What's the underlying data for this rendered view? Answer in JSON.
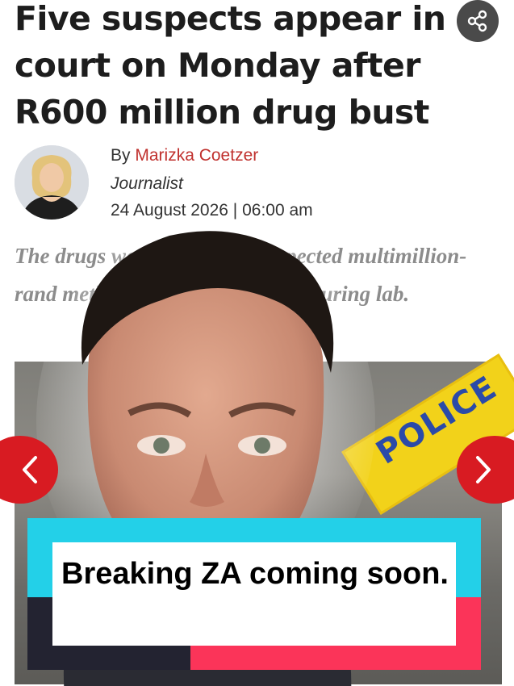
{
  "article": {
    "headline": "Five suspects appear in court on Monday after R600 million drug bust",
    "byline_prefix": "By",
    "author_name": "Marizka Coetzer",
    "author_role": "Journalist",
    "date": "24 August 2026 | 06:00 am",
    "standfirst": "The drugs were found at a suspected multimillion-rand methamphetamine manufacturing lab."
  },
  "photo": {
    "tape_text": "POLICE"
  },
  "caption": {
    "text": "Breaking ZA coming soon."
  },
  "icons": {
    "share": "share-icon",
    "prev": "chevron-left-icon",
    "next": "chevron-right-icon"
  },
  "colors": {
    "author_link": "#c0312e",
    "nav_button": "#d81b22",
    "caption_cyan": "#23d0e8",
    "caption_pink": "#fb3459",
    "caption_dark": "#232331"
  }
}
